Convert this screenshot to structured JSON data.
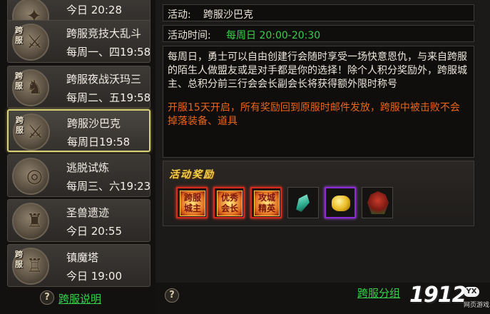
{
  "sidebar": {
    "items": [
      {
        "tag": "",
        "name": "",
        "time": "今日 20:28",
        "icon": "event-emblem-icon",
        "active": false
      },
      {
        "tag": "跨服",
        "name": "跨服竞技大乱斗",
        "time": "每周一、四19:58",
        "icon": "crossed-swords-icon",
        "active": false
      },
      {
        "tag": "跨服",
        "name": "跨服夜战沃玛三",
        "time": "每周二、五19:58",
        "icon": "beast-head-icon",
        "active": false
      },
      {
        "tag": "跨服",
        "name": "跨服沙巴克",
        "time": "每周日19:58",
        "icon": "crossed-swords-icon",
        "active": true
      },
      {
        "tag": "",
        "name": "逃脱试炼",
        "time": "每周三、六19:23",
        "icon": "vortex-icon",
        "active": false
      },
      {
        "tag": "",
        "name": "圣兽遗迹",
        "time": "今日 20:55",
        "icon": "beast-relic-icon",
        "active": false
      },
      {
        "tag": "跨服",
        "name": "镇魔塔",
        "time": "今日 19:00",
        "icon": "pagoda-icon",
        "active": false
      }
    ],
    "help_label": "跨服说明"
  },
  "detail": {
    "activity_label": "活动:",
    "activity_name": "跨服沙巴克",
    "time_label": "活动时间:",
    "time_value": "每周日 20:00-20:30",
    "description": "每周日，勇士可以自由创建行会随时享受一场快意恩仇，与来自跨服的陌生人做盟友或是对手都是你的选择！除个人积分奖励外，跨服城主、总积分前三行会会长副会长将获得额外限时称号",
    "warning": "开服15天开启，所有奖励回到原服时邮件发放，跨服中被击败不会掉落装备、道具",
    "rewards_title": "活动奖励",
    "rewards": [
      {
        "label": "跨服城主",
        "icon": "title-badge-icon",
        "quality": "red"
      },
      {
        "label": "优秀会长",
        "icon": "title-badge-icon",
        "quality": "red"
      },
      {
        "label": "攻城精英",
        "icon": "title-badge-icon",
        "quality": "red"
      },
      {
        "label": "",
        "icon": "crystal-icon",
        "quality": "normal"
      },
      {
        "label": "",
        "icon": "gold-ingot-icon",
        "quality": "purple"
      },
      {
        "label": "",
        "icon": "demon-mask-icon",
        "quality": "normal"
      }
    ],
    "group_link": "跨服分组"
  },
  "logo": {
    "number": "1912",
    "badge": "YX",
    "sub": "网页游戏"
  },
  "colors": {
    "link_green": "#36d04a",
    "time_green": "#36d04a",
    "warning_orange": "#e8641c",
    "reward_gold": "#f2d04a",
    "active_border": "#d9d27a"
  }
}
